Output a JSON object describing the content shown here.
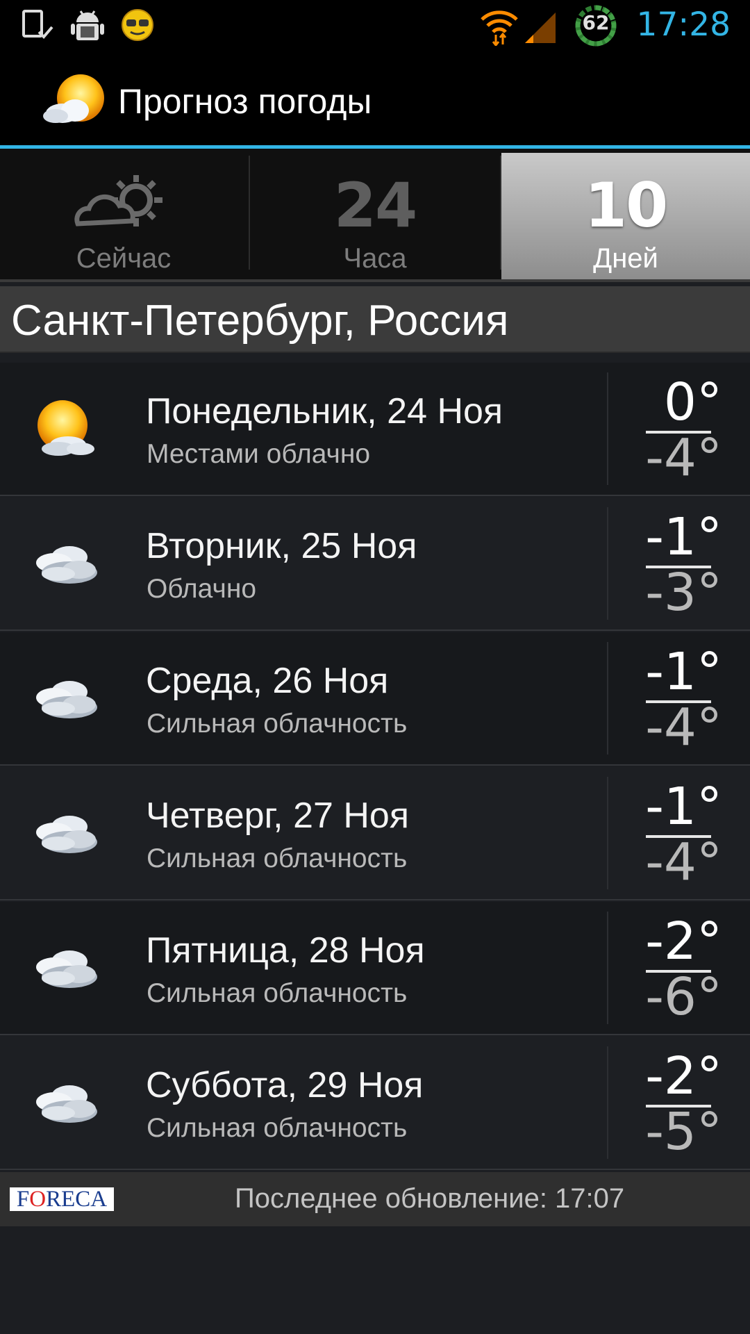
{
  "status_bar": {
    "time": "17:28",
    "battery": "62",
    "icons": [
      "device-check-icon",
      "android-debug-icon",
      "smiley-icon",
      "wifi-icon",
      "signal-icon",
      "battery-icon"
    ]
  },
  "app": {
    "title": "Прогноз погоды",
    "logo_icon": "sun-cloud-icon"
  },
  "tabs": [
    {
      "big": "",
      "icon": "cloud-sun-icon",
      "label": "Сейчас",
      "active": false
    },
    {
      "big": "24",
      "label": "Часа",
      "active": false
    },
    {
      "big": "10",
      "label": "Дней",
      "active": true
    }
  ],
  "location": "Санкт-Петербург, Россия",
  "forecast": [
    {
      "day": "Понедельник, 24 Ноя",
      "desc": "Местами облачно",
      "hi": "0°",
      "lo": "-4°",
      "icon": "partly-cloudy-icon"
    },
    {
      "day": "Вторник, 25 Ноя",
      "desc": "Облачно",
      "hi": "-1°",
      "lo": "-3°",
      "icon": "cloudy-icon"
    },
    {
      "day": "Среда, 26 Ноя",
      "desc": "Сильная облачность",
      "hi": "-1°",
      "lo": "-4°",
      "icon": "overcast-icon"
    },
    {
      "day": "Четверг, 27 Ноя",
      "desc": "Сильная облачность",
      "hi": "-1°",
      "lo": "-4°",
      "icon": "overcast-icon"
    },
    {
      "day": "Пятница, 28 Ноя",
      "desc": "Сильная облачность",
      "hi": "-2°",
      "lo": "-6°",
      "icon": "overcast-icon"
    },
    {
      "day": "Суббота, 29 Ноя",
      "desc": "Сильная облачность",
      "hi": "-2°",
      "lo": "-5°",
      "icon": "overcast-icon"
    }
  ],
  "footer": {
    "provider": "FORECA",
    "updated": "Последнее обновление: 17:07"
  },
  "colors": {
    "accent": "#33b5e5",
    "background": "#1c1e22",
    "active_tab": "#b0b0b0"
  }
}
